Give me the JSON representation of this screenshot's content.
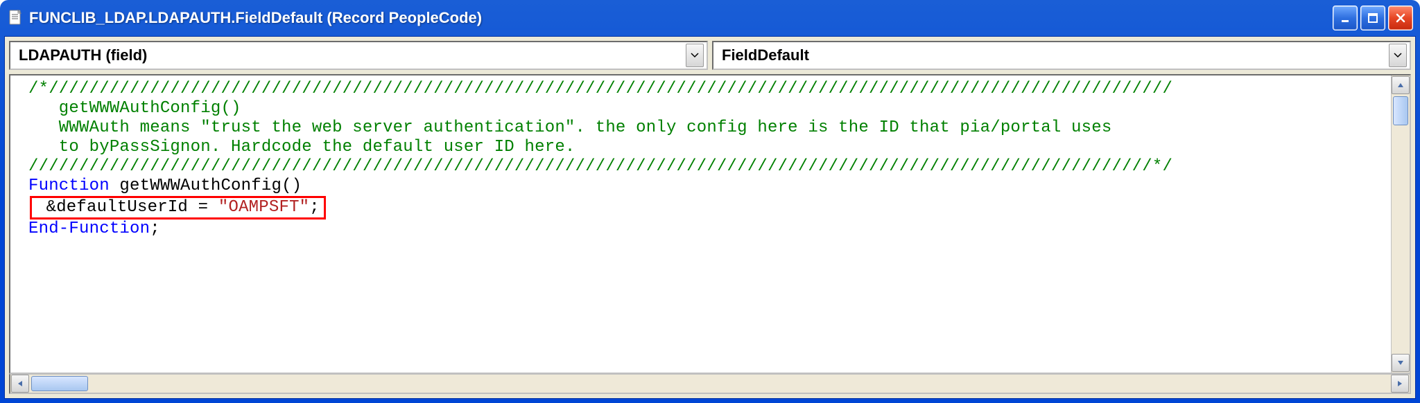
{
  "window": {
    "title": "FUNCLIB_LDAP.LDAPAUTH.FieldDefault (Record PeopleCode)"
  },
  "dropdowns": {
    "field_label": "LDAPAUTH   (field)",
    "event_label": "FieldDefault"
  },
  "code": {
    "comment_open": "/*///////////////////////////////////////////////////////////////////////////////////////////////////////////////",
    "comment_l1": "   getWWWAuthConfig()",
    "comment_l2": "   WWWAuth means \"trust the web server authentication\". the only config here is the ID that pia/portal uses",
    "comment_l3": "   to byPassSignon. Hardcode the default user ID here.",
    "comment_close": "///////////////////////////////////////////////////////////////////////////////////////////////////////////////*/",
    "kw_function": "Function",
    "func_decl": " getWWWAuthConfig()",
    "hl_prefix1": " &defaultUserId",
    "hl_prefix2": " = ",
    "hl_string": "\"OAMPSFT\"",
    "hl_suffix": ";",
    "kw_endfunc": "End-Function",
    "endfunc_suffix": ";"
  },
  "colors": {
    "comment": "#008000",
    "keyword": "#0000ff",
    "string": "#b22222",
    "highlight_border": "#ff0000"
  }
}
